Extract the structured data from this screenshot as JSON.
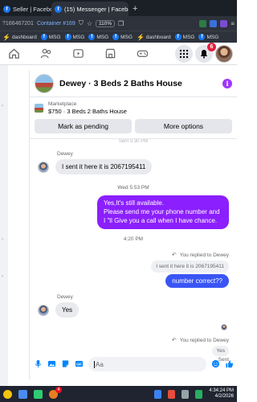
{
  "browser": {
    "tabs": [
      {
        "label": "Seller | Facebook",
        "active": false
      },
      {
        "label": "(15) Messenger | Facebook",
        "active": true
      }
    ],
    "new_tab": "+",
    "address": {
      "url_fragment": "?166467201",
      "container": "Container #169",
      "zoom": "110%"
    },
    "bookmarks": [
      {
        "label": "dashboard"
      },
      {
        "label": "MSG"
      },
      {
        "label": "MSG"
      },
      {
        "label": "MSG"
      },
      {
        "label": "MSG"
      },
      {
        "label": "dashboard"
      },
      {
        "label": "MSG"
      },
      {
        "label": "MSG"
      }
    ]
  },
  "facebook_nav": {
    "icons": [
      "home-icon",
      "friends-icon",
      "watch-icon",
      "marketplace-icon",
      "gaming-icon"
    ],
    "notification_count": "6"
  },
  "chat": {
    "title": "Dewey · 3 Beds 2 Baths House",
    "listing": {
      "label": "Marketplace",
      "description": "$750 · 3 Beds 2 Baths House",
      "primary_action": "Mark as pending",
      "secondary_action": "More options"
    },
    "faint_timestamp": "Sent 5:30 PM",
    "messages": [
      {
        "sender": "Dewey",
        "text": "I sent it here it is 2067195411"
      },
      {
        "timestamp": "Wed 5:53 PM"
      },
      {
        "outgoing": "Yes,It's still available.\nPlease send me your phone number and I \"ll Give you a call when I have chance."
      },
      {
        "timestamp": "4:20 PM"
      }
    ],
    "reply1": {
      "note": "You replied to Dewey",
      "quoted": "I sent it here it is 2067195411",
      "text": "number correct??"
    },
    "incoming2": {
      "sender": "Dewey",
      "text": "Yes"
    },
    "reply2": {
      "note": "You replied to Dewey",
      "quoted": "Yes",
      "status": "Sent"
    },
    "composer": {
      "placeholder": "Aa"
    }
  },
  "taskbar": {
    "badge_count": "4",
    "time": "4:34:24 PM",
    "date": "4/2/2026"
  },
  "colors": {
    "outgoing_bubble": "#8b1ffd",
    "outgoing_bubble_alt": "#3a55f5",
    "messenger_accent": "#a033ff",
    "notification_red": "#e41e3f"
  }
}
